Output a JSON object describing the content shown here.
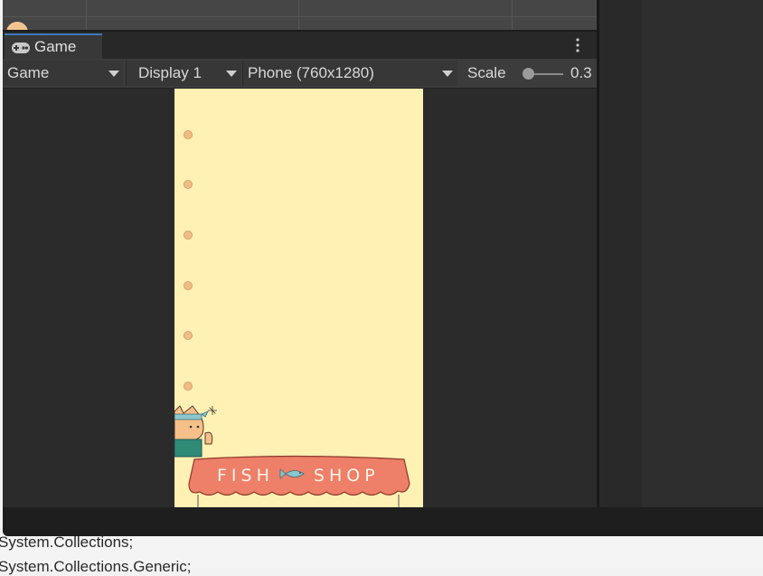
{
  "code_editor": {
    "lines": [
      "System.Collections;",
      "System.Collections.Generic;"
    ]
  },
  "tab": {
    "label": "Game",
    "icon": "gamepad-icon",
    "menu_icon": "kebab-menu-icon"
  },
  "toolbar": {
    "view_mode": "Game",
    "display": "Display 1",
    "resolution": "Phone (760x1280)",
    "scale_label": "Scale",
    "scale_value": "0.3"
  },
  "game": {
    "dot_count": 6,
    "shop_sign": "FISH SHOP",
    "shop_icon": "fish-icon",
    "character": "cat-with-headband"
  },
  "colors": {
    "accent_tab": "#3a79bb",
    "game_background": "#fff0b3",
    "awning": "#ee7f68",
    "dot": "#efbd86"
  }
}
